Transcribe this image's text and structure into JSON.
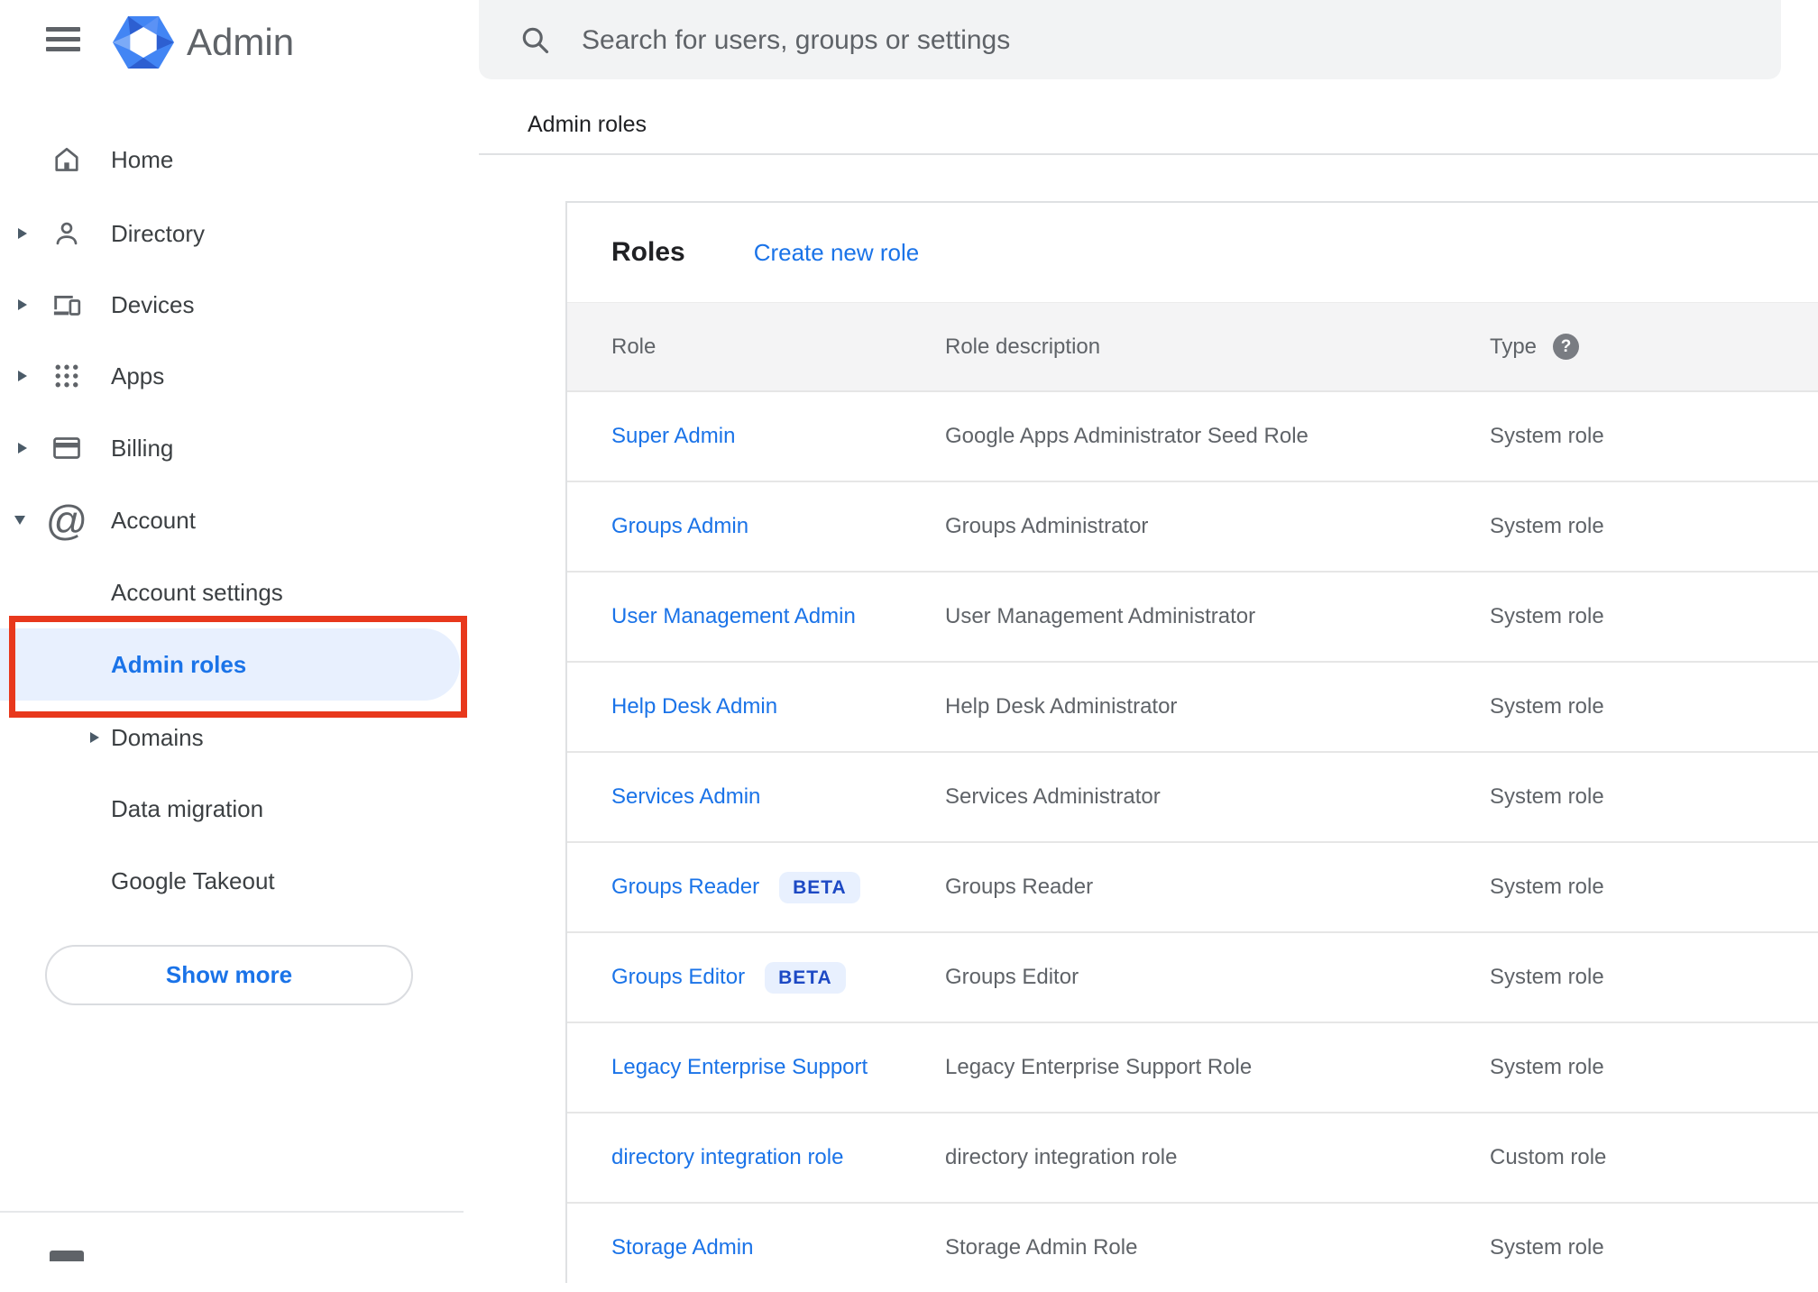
{
  "app": {
    "name": "Admin"
  },
  "search": {
    "placeholder": "Search for users, groups or settings"
  },
  "breadcrumb": "Admin roles",
  "sidebar": {
    "items": [
      {
        "label": "Home"
      },
      {
        "label": "Directory"
      },
      {
        "label": "Devices"
      },
      {
        "label": "Apps"
      },
      {
        "label": "Billing"
      },
      {
        "label": "Account"
      },
      {
        "label": "Account settings"
      },
      {
        "label": "Admin roles",
        "active": true
      },
      {
        "label": "Domains"
      },
      {
        "label": "Data migration"
      },
      {
        "label": "Google Takeout"
      }
    ],
    "show_more_label": "Show more"
  },
  "card": {
    "title": "Roles",
    "create_link": "Create new role",
    "columns": [
      "Role",
      "Role description",
      "Type"
    ],
    "help_icon_glyph": "?",
    "rows": [
      {
        "role": "Super Admin",
        "description": "Google Apps Administrator Seed Role",
        "type": "System role"
      },
      {
        "role": "Groups Admin",
        "description": "Groups Administrator",
        "type": "System role"
      },
      {
        "role": "User Management Admin",
        "description": "User Management Administrator",
        "type": "System role"
      },
      {
        "role": "Help Desk Admin",
        "description": "Help Desk Administrator",
        "type": "System role"
      },
      {
        "role": "Services Admin",
        "description": "Services Administrator",
        "type": "System role"
      },
      {
        "role": "Groups Reader",
        "badge": "BETA",
        "description": "Groups Reader",
        "type": "System role"
      },
      {
        "role": "Groups Editor",
        "badge": "BETA",
        "description": "Groups Editor",
        "type": "System role"
      },
      {
        "role": "Legacy Enterprise Support",
        "description": "Legacy Enterprise Support Role",
        "type": "System role"
      },
      {
        "role": "directory integration role",
        "description": "directory integration role",
        "type": "Custom role"
      },
      {
        "role": "Storage Admin",
        "description": "Storage Admin Role",
        "type": "System role"
      }
    ]
  },
  "colors": {
    "accent_blue": "#1a73e8",
    "badge_bg": "#e8f0fe",
    "badge_text": "#1d49c4",
    "annotation_red": "#e8381c",
    "header_row_bg": "#f4f4f5"
  }
}
